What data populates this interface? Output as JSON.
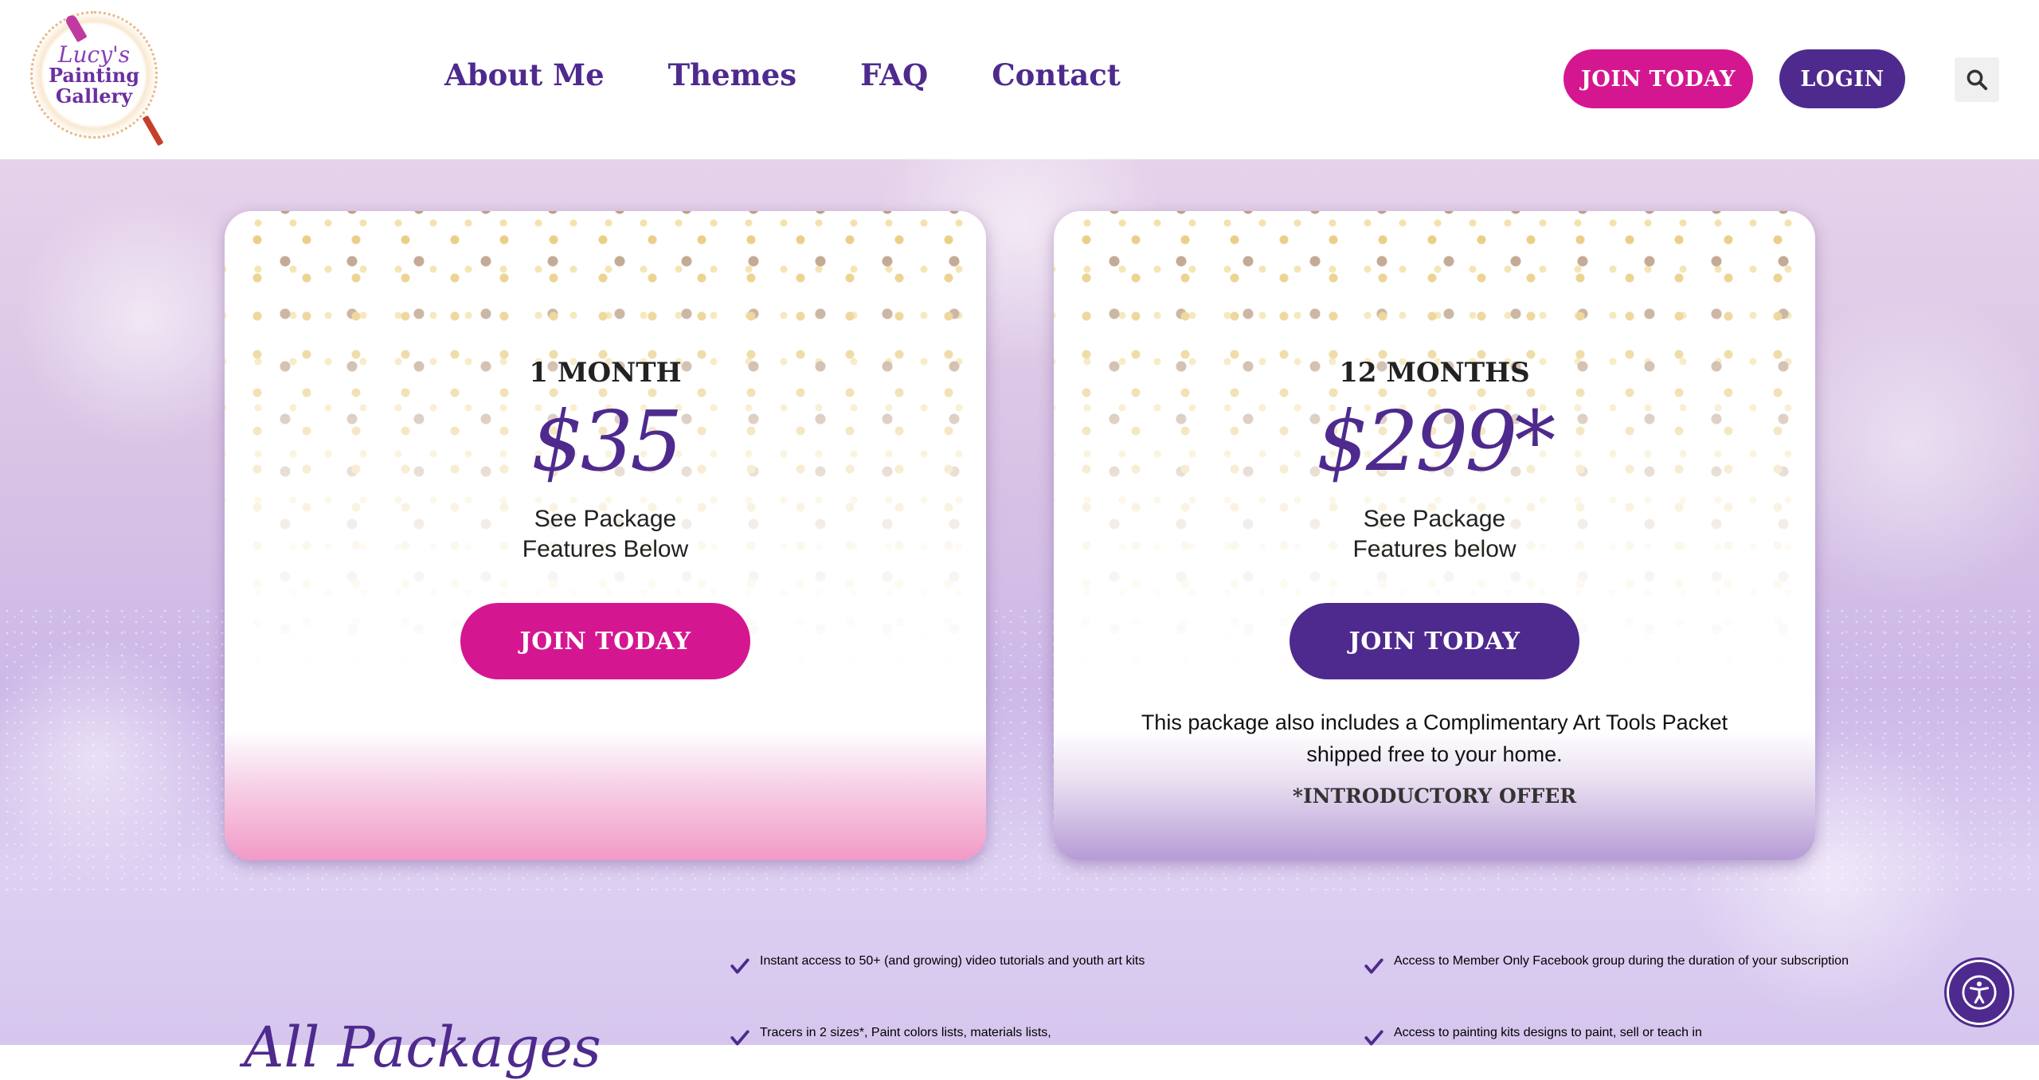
{
  "header": {
    "logo": {
      "line1": "Lucy's",
      "line2": "Painting",
      "line3": "Gallery"
    },
    "nav": [
      "About Me",
      "Themes",
      "FAQ",
      "Contact"
    ],
    "join_label": "JOIN TODAY",
    "login_label": "LOGIN"
  },
  "plans": [
    {
      "title": "1 MONTH",
      "price": "$35",
      "subtitle_line1": "See Package",
      "subtitle_line2": "Features Below",
      "button": "JOIN TODAY",
      "note": "",
      "offer": ""
    },
    {
      "title": "12 MONTHS",
      "price": "$299*",
      "subtitle_line1": "See Package",
      "subtitle_line2": "Features below",
      "button": "JOIN TODAY",
      "note": "This package also includes a Complimentary Art Tools Packet shipped free to your home.",
      "offer": "*INTRODUCTORY OFFER"
    }
  ],
  "features": {
    "heading": "All Packages",
    "items": [
      "Instant access to 50+ (and growing) video tutorials and youth art kits",
      "Tracers in 2 sizes*, Paint colors lists, materials lists,",
      "Access to Member Only Facebook group during the duration of your subscription",
      "Access to painting kits designs to paint, sell or teach in"
    ]
  },
  "colors": {
    "brand_purple": "#4e2a8e",
    "brand_pink": "#d41790"
  },
  "icons": {
    "search": "search-icon",
    "check": "check-icon",
    "accessibility": "accessibility-icon"
  }
}
